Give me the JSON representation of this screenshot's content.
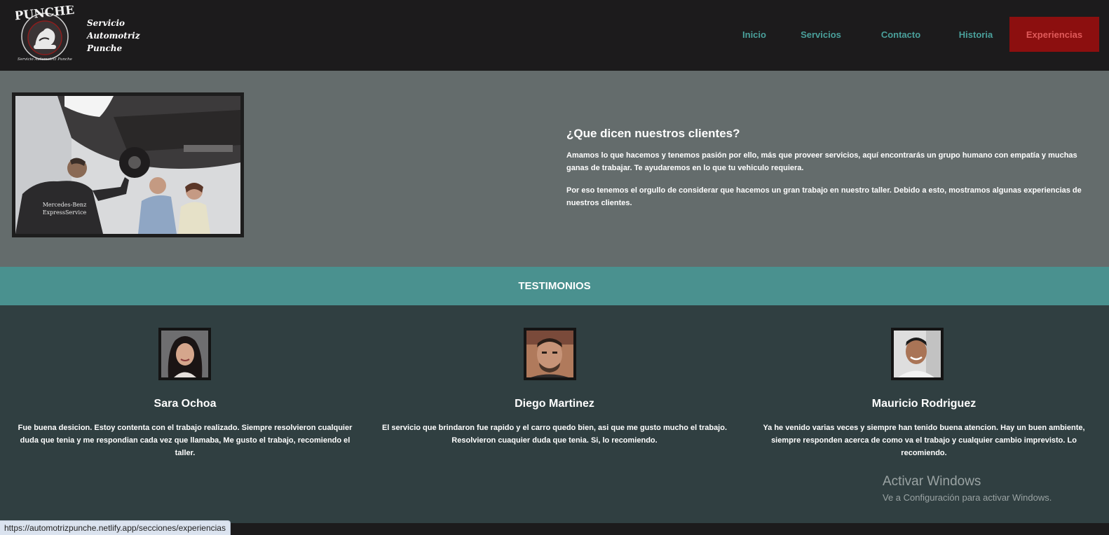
{
  "header": {
    "logo_text": "PUNCHE",
    "logo_subtext": "Servicio Automotriz Punche",
    "brand_lines": [
      "Servicio",
      "Automotriz",
      "Punche"
    ]
  },
  "nav": {
    "items": [
      {
        "label": "Inicio"
      },
      {
        "label": "Servicios"
      },
      {
        "label": "Contacto"
      },
      {
        "label": "Historia"
      },
      {
        "label": "Experiencias"
      }
    ],
    "active": "Experiencias",
    "active_color": "#8c0f0f",
    "link_color": "#4aa09b"
  },
  "intro": {
    "photo_text": [
      "Mercedes-Benz",
      "ExpressService"
    ],
    "title": "¿Que dicen nuestros clientes?",
    "paragraph1": "Amamos lo que hacemos y tenemos pasión por ello, más que proveer servicios, aquí encontrarás un grupo humano con empatía y muchas ganas de trabajar. Te ayudaremos en lo que tu vehiculo requiera.",
    "paragraph2": "Por eso tenemos el orgullo de considerar que hacemos un gran trabajo en nuestro taller. Debido a esto, mostramos algunas experiencias de nuestros clientes."
  },
  "testimonials": {
    "title": "TESTIMONIOS",
    "items": [
      {
        "name": "Sara Ochoa",
        "quote": "Fue buena desicion. Estoy contenta con el trabajo realizado. Siempre resolvieron cualquier duda que tenia y me respondian cada vez que llamaba, Me gusto el trabajo, recomiendo el taller."
      },
      {
        "name": "Diego Martinez",
        "quote": "El servicio que brindaron fue rapido y el carro quedo bien, asi que me gusto mucho el trabajo. Resolvieron cuaquier duda que tenia. Si, lo recomiendo."
      },
      {
        "name": "Mauricio Rodriguez",
        "quote": "Ya he venido varias veces y siempre han tenido buena atencion. Hay un buen ambiente, siempre responden acerca de como va el trabajo y cualquier cambio imprevisto. Lo recomiendo."
      }
    ]
  },
  "watermark": {
    "title": "Activar Windows",
    "subtitle": "Ve a Configuración para activar Windows."
  },
  "status_url": "https://automotrizpunche.netlify.app/secciones/experiencias"
}
